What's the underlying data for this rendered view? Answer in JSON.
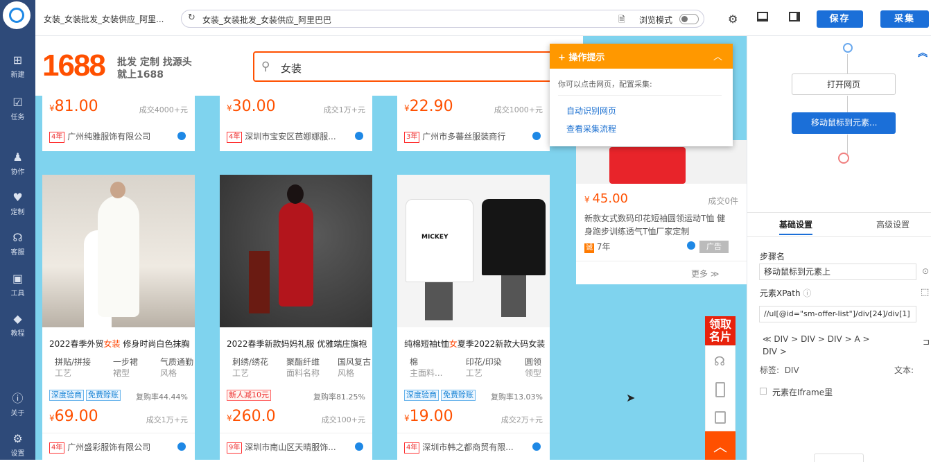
{
  "app": {
    "tab_title": "女装_女装批发_女装供应_阿里...",
    "url": "女装_女装批发_女装供应_阿里巴巴",
    "browse_mode_label": "浏览模式",
    "save_label": "保存",
    "collect_label": "采集"
  },
  "sidebar": [
    {
      "label": "新建",
      "icon": "plus-icon"
    },
    {
      "label": "任务",
      "icon": "task-icon"
    },
    {
      "label": "协作",
      "icon": "team-icon"
    },
    {
      "label": "定制",
      "icon": "heart-icon"
    },
    {
      "label": "客服",
      "icon": "headset-icon"
    },
    {
      "label": "工具",
      "icon": "toolbox-icon"
    },
    {
      "label": "教程",
      "icon": "graduation-icon"
    },
    {
      "label": "关于",
      "icon": "info-icon"
    },
    {
      "label": "设置",
      "icon": "gear-icon"
    }
  ],
  "site": {
    "logo": "1688",
    "slogan1": "批发 定制 找源头",
    "slogan2": "就上1688",
    "search_value": "女装"
  },
  "top_row": [
    {
      "price": "81.00",
      "sold": "成交4000+元",
      "years": "4年",
      "shop": "广州纯雅服饰有限公司"
    },
    {
      "price": "30.00",
      "sold": "成交1万+元",
      "years": "4年",
      "shop": "深圳市宝安区芭娜娜服..."
    },
    {
      "price": "22.90",
      "sold": "成交1000+元",
      "years": "3年",
      "shop": "广州市多蕃丝服装商行"
    }
  ],
  "products": [
    {
      "title_pre": "2022春季外贸",
      "title_hl": "女装",
      "title_post": " 修身时尚白色抹胸",
      "attrs": [
        [
          "拼贴/拼接",
          "工艺"
        ],
        [
          "一步裙",
          "裙型"
        ],
        [
          "气质通勤",
          "风格"
        ]
      ],
      "tags": [
        "深度验商",
        "免费赊账"
      ],
      "tag_style": "blue",
      "rate": "复购率44.44%",
      "price": "69.00",
      "sold": "成交1万+元",
      "years": "4年",
      "shop": "广州盛彩服饰有限公司"
    },
    {
      "title_pre": "2022春季新款妈妈礼服 优雅端庄旗袍",
      "title_hl": "",
      "title_post": "",
      "attrs": [
        [
          "刺绣/绣花",
          "工艺"
        ],
        [
          "聚酯纤维",
          "面料名称"
        ],
        [
          "国风复古",
          "风格"
        ]
      ],
      "tags": [
        "新人减10元"
      ],
      "tag_style": "red",
      "rate": "复购率81.25%",
      "price": "260.0",
      "sold": "成交100+元",
      "years": "9年",
      "shop": "深圳市南山区天晴服饰..."
    },
    {
      "title_pre": "纯棉短袖t恤",
      "title_hl": "女",
      "title_post": "夏季2022新款大码女装",
      "attrs": [
        [
          "棉",
          "主面料..."
        ],
        [
          "印花/印染",
          "工艺"
        ],
        [
          "圆领",
          "领型"
        ]
      ],
      "tags": [
        "深度验商",
        "免费赊账"
      ],
      "tag_style": "blue",
      "rate": "复购率13.03%",
      "price": "19.00",
      "sold": "成交2万+元",
      "years": "4年",
      "shop": "深圳市韩之都商贸有限..."
    }
  ],
  "side_card": {
    "price": "45.00",
    "sold": "成交0件",
    "desc": "新款女式数码印花短袖圆领运动T恤 健身跑步训练透气T恤厂家定制",
    "years": "7年",
    "ad": "广告",
    "more": "更多"
  },
  "popup": {
    "title": "操作提示",
    "desc": "你可以点击网页，配置采集:",
    "link1": "自动识别网页",
    "link2": "查看采集流程"
  },
  "float_bar": {
    "coupon": "领取名片"
  },
  "flow": {
    "step1": "打开网页",
    "step2": "移动鼠标到元素..."
  },
  "settings": {
    "tab_basic": "基础设置",
    "tab_advanced": "高级设置",
    "step_name_label": "步骤名",
    "step_name_value": "移动鼠标到元素上",
    "xpath_label": "元素XPath",
    "xpath_value": "//ul[@id=\"sm-offer-list\"]/div[24]/div[1]",
    "breadcrumb": [
      "DIV",
      "DIV",
      "DIV",
      "A",
      "DIV"
    ],
    "tag_label": "标签:",
    "tag_value": "DIV",
    "text_label": "文本:",
    "iframe_label": "元素在Iframe里"
  },
  "colors": {
    "brand_orange": "#ff5000",
    "primary_blue": "#1b6fd8",
    "sidebar": "#2e4a79",
    "page_bg": "#7fd3ee"
  }
}
